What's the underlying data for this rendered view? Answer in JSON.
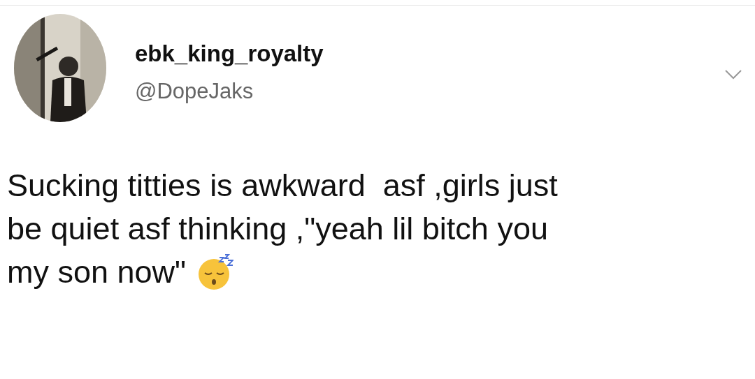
{
  "tweet": {
    "author": {
      "name": "ebk_king_royalty",
      "handle": "@DopeJaks"
    },
    "lines": [
      "Sucking titties is awkward  asf ,girls just",
      "be quiet asf thinking ,\"yeah lil bitch you",
      "my son now\""
    ]
  }
}
